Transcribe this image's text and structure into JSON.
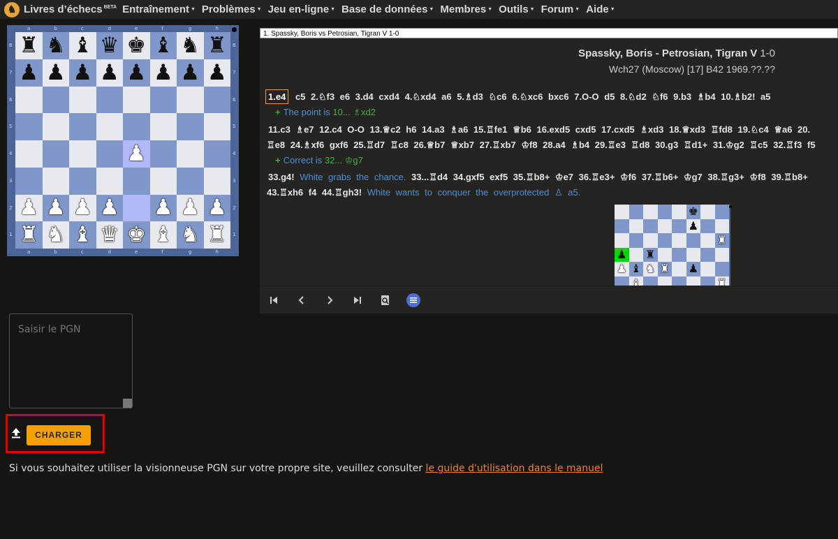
{
  "nav": {
    "brand": "Livres d’échecs",
    "beta": "BETA",
    "items": [
      "Entraînement",
      "Problèmes",
      "Jeu en-ligne",
      "Base de données",
      "Membres",
      "Outils",
      "Forum",
      "Aide"
    ]
  },
  "board": {
    "files": [
      "a",
      "b",
      "c",
      "d",
      "e",
      "f",
      "g",
      "h"
    ],
    "ranks": [
      "8",
      "7",
      "6",
      "5",
      "4",
      "3",
      "2",
      "1"
    ],
    "position": [
      [
        "br",
        "bn",
        "bb",
        "bq",
        "bk",
        "bb",
        "bn",
        "br"
      ],
      [
        "bp",
        "bp",
        "bp",
        "bp",
        "bp",
        "bp",
        "bp",
        "bp"
      ],
      [
        "",
        "",
        "",
        "",
        "",
        "",
        "",
        ""
      ],
      [
        "",
        "",
        "",
        "",
        "",
        "",
        "",
        ""
      ],
      [
        "",
        "",
        "",
        "",
        "wp",
        "",
        "",
        ""
      ],
      [
        "",
        "",
        "",
        "",
        "",
        "",
        "",
        ""
      ],
      [
        "wp",
        "wp",
        "wp",
        "wp",
        "",
        "wp",
        "wp",
        "wp"
      ],
      [
        "wr",
        "wn",
        "wb",
        "wq",
        "wk",
        "wb",
        "wn",
        "wr"
      ]
    ],
    "highlight": [
      "e4",
      "e2"
    ]
  },
  "viewer": {
    "game_select": "1. Spassky, Boris vs Petrosian, Tigran V 1-0",
    "players": "Spassky, Boris - Petrosian, Tigran V",
    "result": "1-0",
    "event": "Wch27 (Moscow) [17] B42 1969.??.??",
    "current_move": "1.e4",
    "line1": "c5  2.♘f3  e6  3.d4  cxd4  4.♘xd4  a6  5.♗d3  ♘c6  6.♘xc6  bxc6  7.O-O  d5  8.♘d2  ♘f6  9.b3  ♗b4  10.♗b2!  a5",
    "comment1_text": "The point is",
    "comment1_move": "10... ♗xd2",
    "line2": "11.c3  ♗e7  12.c4  O-O  13.♕c2  h6  14.a3  ♗a6  15.♖fe1  ♕b6  16.exd5  cxd5  17.cxd5  ♗xd3  18.♕xd3  ♖fd8  19.♘c4  ♕a6  20.",
    "line3": "♖e8  24.♗xf6  gxf6  25.♖d7  ♖c8  26.♕b7  ♕xb7  27.♖xb7  ♔f8  28.a4  ♗b4  29.♖e3  ♖d8  30.g3  ♖d1+  31.♔g2  ♖c5  32.♖f3  f5",
    "comment2_text": "Correct is",
    "comment2_move": "32... ♔g7",
    "line4_move": "33.g4!",
    "line4_note": "White grabs the chance.",
    "line4_rest": "33...♖d4  34.gxf5  exf5  35.♖b8+  ♔e7  36.♖e3+  ♔f6  37.♖b6+  ♔g7  38.♖g3+  ♔f8  39.♖b8+",
    "line5": "43.♖xh6  f4  44.♖gh3!",
    "line5_note": "White wants to conquer the overprotected ♙ a5.",
    "diagram": [
      [
        "",
        "",
        "",
        "",
        "",
        "bk",
        "",
        ""
      ],
      [
        "",
        "",
        "",
        "",
        "",
        "bp",
        "",
        ""
      ],
      [
        "",
        "",
        "",
        "",
        "",
        "",
        "",
        "wr"
      ],
      [
        "bp",
        "",
        "br",
        "",
        "",
        "",
        "",
        ""
      ],
      [
        "wp",
        "bb",
        "wn",
        "wr",
        "",
        "bp",
        "",
        ""
      ],
      [
        "",
        "wb",
        "",
        "",
        "",
        "",
        "",
        "wr"
      ]
    ],
    "toolbar": [
      "first-icon",
      "prev-icon",
      "next-icon",
      "last-icon",
      "zoom-icon",
      "menu-icon"
    ]
  },
  "pgn": {
    "placeholder": "Saisir le PGN",
    "load_button": "CHARGER"
  },
  "footer": {
    "text": "Si vous souhaitez utiliser la visionneuse PGN sur votre propre site, veuillez consulter",
    "link": "le guide d'utilisation dans le manuel"
  },
  "colors": {
    "accent": "#f6a000",
    "highlight_box": "#e00000",
    "comment": "#4a90d9",
    "comment_move": "#3cb043"
  }
}
